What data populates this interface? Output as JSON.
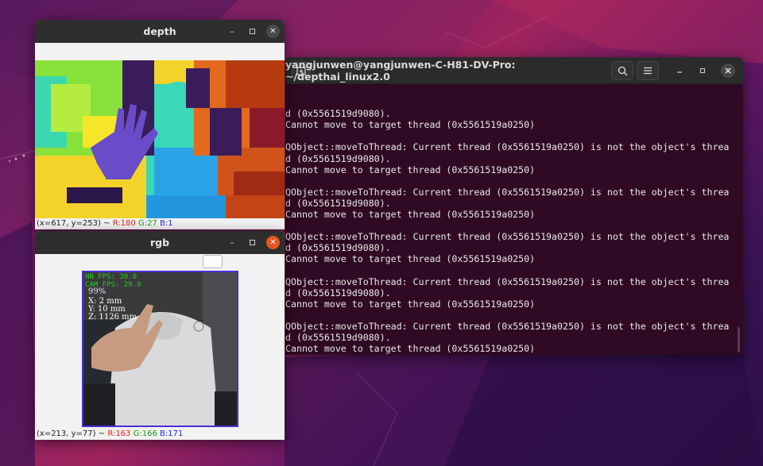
{
  "terminal": {
    "title": "yangjunwen@yangjunwen-C-H81-DV-Pro: ~/depthai_linux2.0",
    "lines": [
      "d (0x5561519d9080).",
      "Cannot move to target thread (0x5561519a0250)",
      "",
      "QObject::moveToThread: Current thread (0x5561519a0250) is not the object's threa",
      "d (0x5561519d9080).",
      "Cannot move to target thread (0x5561519a0250)",
      "",
      "QObject::moveToThread: Current thread (0x5561519a0250) is not the object's threa",
      "d (0x5561519d9080).",
      "Cannot move to target thread (0x5561519a0250)",
      "",
      "QObject::moveToThread: Current thread (0x5561519a0250) is not the object's threa",
      "d (0x5561519d9080).",
      "Cannot move to target thread (0x5561519a0250)",
      "",
      "QObject::moveToThread: Current thread (0x5561519a0250) is not the object's threa",
      "d (0x5561519d9080).",
      "Cannot move to target thread (0x5561519a0250)",
      "",
      "QObject::moveToThread: Current thread (0x5561519a0250) is not the object's threa",
      "d (0x5561519d9080).",
      "Cannot move to target thread (0x5561519a0250)"
    ],
    "icons": {
      "new_tab": "new-tab-icon",
      "search": "search-icon",
      "menu": "hamburger-menu-icon",
      "minimize": "minimize-icon",
      "maximize": "maximize-icon",
      "close": "close-icon"
    }
  },
  "depth_window": {
    "title": "depth",
    "status_coords": "(x=617, y=253) ~",
    "status_r": "R:180",
    "status_g": "G:27",
    "status_b": "B:1"
  },
  "rgb_window": {
    "title": "rgb",
    "status_coords": "(x=213, y=77) ~",
    "status_r": "R:163",
    "status_g": "G:166",
    "status_b": "B:171",
    "overlay": {
      "nn_fps": "NN FPS: 30.0",
      "cam_fps": "CAM FPS: 29.9",
      "confidence": "99%",
      "x": "X: 2 mm",
      "y": "Y: 10 mm",
      "z": "Z: 1126 mm"
    },
    "close_color": "#e95420"
  },
  "colors": {
    "terminal_bg": "#300a24",
    "accent": "#e95420",
    "bbox": "#4b2cd8"
  }
}
